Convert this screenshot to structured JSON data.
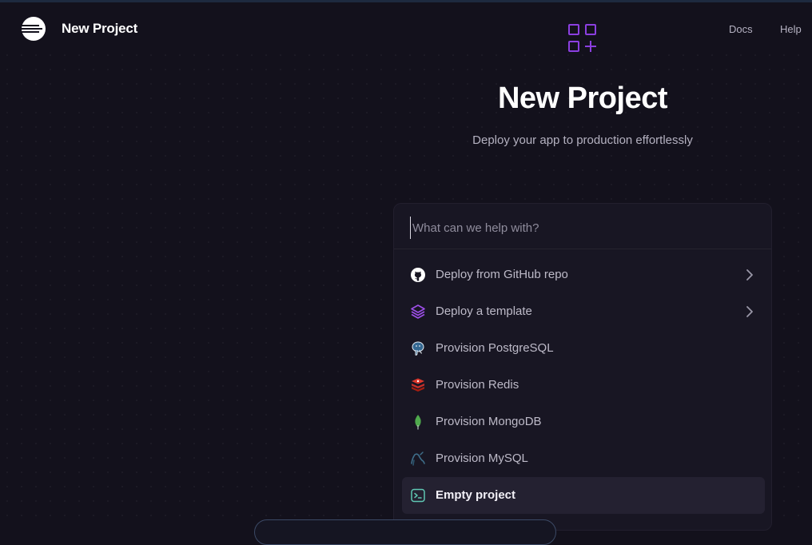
{
  "header": {
    "app_title": "New Project",
    "nav": {
      "docs": "Docs",
      "help": "Help"
    }
  },
  "hero": {
    "title": "New Project",
    "subtitle": "Deploy your app to production effortlessly",
    "icon": "grid-plus-icon"
  },
  "search": {
    "placeholder": "What can we help with?",
    "value": ""
  },
  "menu": {
    "items": [
      {
        "label": "Deploy from GitHub repo",
        "icon": "github-icon",
        "has_chevron": true
      },
      {
        "label": "Deploy a template",
        "icon": "layers-icon",
        "has_chevron": true
      },
      {
        "label": "Provision PostgreSQL",
        "icon": "postgresql-icon",
        "has_chevron": false
      },
      {
        "label": "Provision Redis",
        "icon": "redis-icon",
        "has_chevron": false
      },
      {
        "label": "Provision MongoDB",
        "icon": "mongodb-icon",
        "has_chevron": false
      },
      {
        "label": "Provision MySQL",
        "icon": "mysql-icon",
        "has_chevron": false
      },
      {
        "label": "Empty project",
        "icon": "terminal-icon",
        "has_chevron": false,
        "selected": true
      }
    ]
  },
  "colors": {
    "background": "#13111c",
    "panel": "#181623",
    "accent_purple": "#8b3fe0",
    "selected_row": "#242131"
  }
}
